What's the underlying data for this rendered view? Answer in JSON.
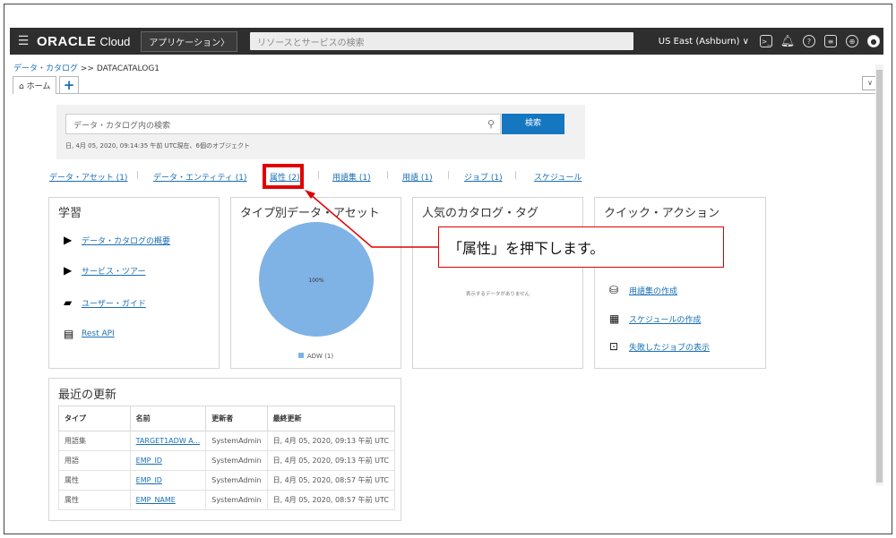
{
  "topbar": {
    "brand": "ORACLE",
    "brand_sub": "Cloud",
    "app_menu": "アプリケーション〉",
    "search_placeholder": "リソースとサービスの検索",
    "region": "US East (Ashburn) ∨"
  },
  "breadcrumb": {
    "root": "データ・カタログ",
    "separator": " >> ",
    "current": "DATACATALOG1"
  },
  "tabs": {
    "home": "ホーム",
    "add": "+",
    "collapse": "∨"
  },
  "search": {
    "placeholder": "データ・カタログ内の検索",
    "button": "検索",
    "meta": "日, 4月 05, 2020, 09:14:35 午前 UTC現在、6個のオブジェクト"
  },
  "filters": [
    {
      "label": "データ・アセット (1)"
    },
    {
      "label": "データ・エンティティ (1)"
    },
    {
      "label": "属性 (2)"
    },
    {
      "label": "用語集 (1)"
    },
    {
      "label": "用語 (1)"
    },
    {
      "label": "ジョブ (1)"
    },
    {
      "label": "スケジュール"
    }
  ],
  "learning": {
    "title": "学習",
    "items": [
      {
        "label": "データ・カタログの概要"
      },
      {
        "label": "サービス・ツアー"
      },
      {
        "label": "ユーザー・ガイド"
      },
      {
        "label": "Rest API"
      }
    ]
  },
  "type_chart": {
    "title": "タイプ別データ・アセット",
    "legend": "ADW (1)",
    "color": "#7fb2e5"
  },
  "chart_data": {
    "type": "pie",
    "title": "タイプ別データ・アセット",
    "categories": [
      "ADW"
    ],
    "values": [
      100
    ],
    "labels": [
      "100%"
    ],
    "legend": [
      "ADW (1)"
    ]
  },
  "popular_tags": {
    "title": "人気のカタログ・タグ",
    "empty": "表示するデータがありません"
  },
  "quick_actions": {
    "title": "クイック・アクション",
    "items": [
      {
        "label": "用語集の作成"
      },
      {
        "label": "スケジュールの作成"
      },
      {
        "label": "失敗したジョブの表示"
      }
    ]
  },
  "callout": {
    "text": "「属性」を押下します。",
    "color": "#e00000"
  },
  "recent": {
    "title": "最近の更新",
    "columns": [
      "タイプ",
      "名前",
      "更新者",
      "最終更新"
    ],
    "rows": [
      [
        "用語集",
        "TARGET1ADW A...",
        "SystemAdmin",
        "日, 4月 05, 2020, 09:13 午前 UTC"
      ],
      [
        "用語",
        "EMP_ID",
        "SystemAdmin",
        "日, 4月 05, 2020, 09:13 午前 UTC"
      ],
      [
        "属性",
        "EMP_ID",
        "SystemAdmin",
        "日, 4月 05, 2020, 08:57 午前 UTC"
      ],
      [
        "属性",
        "EMP_NAME",
        "SystemAdmin",
        "日, 4月 05, 2020, 08:57 午前 UTC"
      ]
    ]
  }
}
